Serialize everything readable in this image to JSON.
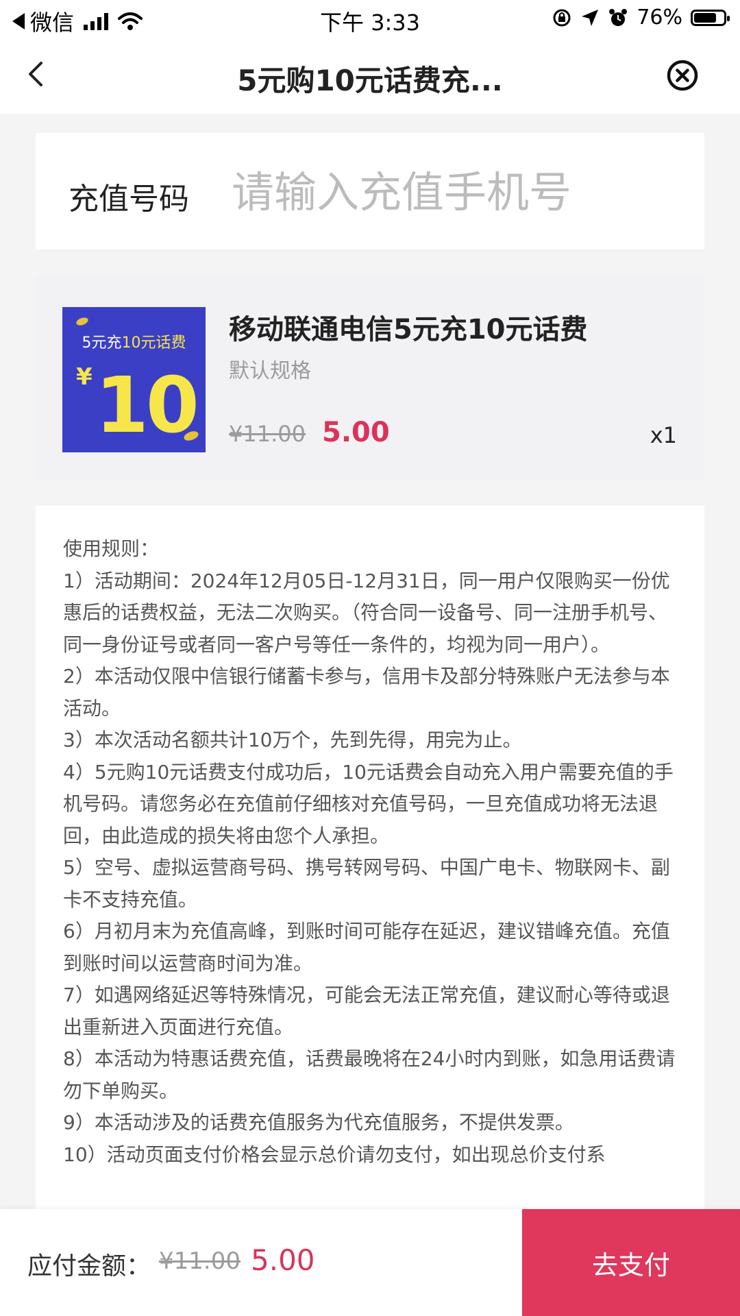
{
  "status_bar": {
    "app_name": "微信",
    "time": "下午 3:33",
    "battery_text": "76%",
    "battery_level": 0.76
  },
  "nav": {
    "title": "5元购10元话费充..."
  },
  "phone_input": {
    "label": "充值号码",
    "value": "",
    "placeholder": "请输入充值手机号"
  },
  "product": {
    "thumb_caption_a": "5元充",
    "thumb_caption_b": "10元话费",
    "thumb_yen": "¥",
    "thumb_number": "10",
    "title": "移动联通电信5元充10元话费",
    "spec": "默认规格",
    "original_price": "¥11.00",
    "price": "5.00",
    "quantity": "x1"
  },
  "rules": {
    "heading": "使用规则：",
    "items": [
      "1）活动期间：2024年12月05日-12月31日，同一用户仅限购买一份优惠后的话费权益，无法二次购买。（符合同一设备号、同一注册手机号、同一身份证号或者同一客户号等任一条件的，均视为同一用户）。",
      "2）本活动仅限中信银行储蓄卡参与，信用卡及部分特殊账户无法参与本活动。",
      "3）本次活动名额共计10万个，先到先得，用完为止。",
      "4）5元购10元话费支付成功后，10元话费会自动充入用户需要充值的手机号码。请您务必在充值前仔细核对充值号码，一旦充值成功将无法退回，由此造成的损失将由您个人承担。",
      "5）空号、虚拟运营商号码、携号转网号码、中国广电卡、物联网卡、副卡不支持充值。",
      "6）月初月末为充值高峰，到账时间可能存在延迟，建议错峰充值。充值到账时间以运营商时间为准。",
      "7）如遇网络延迟等特殊情况，可能会无法正常充值，建议耐心等待或退出重新进入页面进行充值。",
      "8）本活动为特惠话费充值，话费最晚将在24小时内到账，如急用话费请勿下单购买。",
      "9）本活动涉及的话费充值服务为代充值服务，不提供发票。",
      "10）活动页面支付价格会显示总价请勿支付，如出现总价支付系"
    ]
  },
  "footer": {
    "label": "应付金额：",
    "original_price": "¥11.00",
    "price": "5.00",
    "pay_label": "去支付"
  },
  "colors": {
    "accent": "#e0375c",
    "price": "#dc3259",
    "thumb_bg": "#3b3fc6",
    "thumb_yellow": "#f6e64a"
  }
}
